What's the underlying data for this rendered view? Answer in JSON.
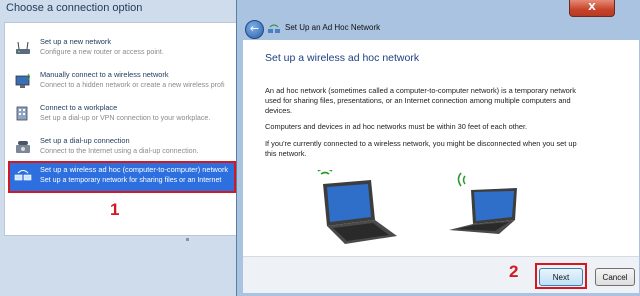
{
  "back_window": {
    "title": "Choose a connection option",
    "options": [
      {
        "title": "Set up a new network",
        "desc": "Configure a new router or access point.",
        "icon": "router-icon"
      },
      {
        "title": "Manually connect to a wireless network",
        "desc": "Connect to a hidden network or create a new wireless profi",
        "icon": "wireless-monitor-icon"
      },
      {
        "title": "Connect to a workplace",
        "desc": "Set up a dial-up or VPN connection to your workplace.",
        "icon": "workplace-icon"
      },
      {
        "title": "Set up a dial-up connection",
        "desc": "Connect to the Internet using a dial-up connection.",
        "icon": "phone-icon"
      },
      {
        "title": "Set up a wireless ad hoc (computer-to-computer) network",
        "desc": "Set up a temporary network for sharing files or an Internet",
        "icon": "adhoc-network-icon",
        "selected": true
      }
    ],
    "step_marker": "1"
  },
  "wizard": {
    "window_title": "Set Up an Ad Hoc Network",
    "close_label": "X",
    "heading": "Set up a wireless ad hoc network",
    "para1": "An ad hoc network (sometimes called a computer-to-computer network) is a temporary network used for sharing files, presentations, or an Internet connection among multiple computers and devices.",
    "para2": "Computers and devices in ad hoc networks must be within 30 feet of each other.",
    "para3": "If you're currently connected to a wireless network, you might be disconnected when you set up this network.",
    "next_label": "Next",
    "cancel_label": "Cancel",
    "step_marker": "2"
  },
  "colors": {
    "selection": "#2e6fe0",
    "highlight": "#d41820",
    "heading": "#1e3f82"
  }
}
